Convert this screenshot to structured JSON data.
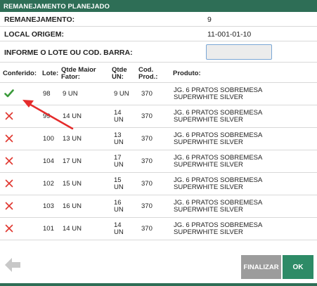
{
  "header": {
    "title": "REMANEJAMENTO PLANEJADO"
  },
  "info": {
    "remanejamento_label": "REMANEJAMENTO:",
    "remanejamento_value": "9",
    "local_origem_label": "LOCAL ORIGEM:",
    "local_origem_value": "11-001-01-10",
    "lote_label": "INFORME O LOTE OU COD. BARRA:",
    "lote_value": ""
  },
  "table": {
    "headers": {
      "conferido": "Conferido:",
      "lote": "Lote:",
      "qtde_maior_fator_1": "Qtde Maior",
      "qtde_maior_fator_2": "Fator:",
      "qtde_un_1": "Qtde",
      "qtde_un_2": "UN:",
      "cod_prod_1": "Cod.",
      "cod_prod_2": "Prod.:",
      "produto": "Produto:"
    },
    "rows": [
      {
        "status": "checked",
        "lote": "98",
        "qtde_maior_fator": "9 UN",
        "qtde_un_1": "9 UN",
        "qtde_un_2": "",
        "cod_prod": "370",
        "produto_1": "JG. 6 PRATOS SOBREMESA",
        "produto_2": "SUPERWHITE SILVER"
      },
      {
        "status": "unchecked",
        "lote": "99",
        "qtde_maior_fator": "14 UN",
        "qtde_un_1": "14",
        "qtde_un_2": "UN",
        "cod_prod": "370",
        "produto_1": "JG. 6 PRATOS SOBREMESA",
        "produto_2": "SUPERWHITE SILVER"
      },
      {
        "status": "unchecked",
        "lote": "100",
        "qtde_maior_fator": "13 UN",
        "qtde_un_1": "13",
        "qtde_un_2": "UN",
        "cod_prod": "370",
        "produto_1": "JG. 6 PRATOS SOBREMESA",
        "produto_2": "SUPERWHITE SILVER"
      },
      {
        "status": "unchecked",
        "lote": "104",
        "qtde_maior_fator": "17 UN",
        "qtde_un_1": "17",
        "qtde_un_2": "UN",
        "cod_prod": "370",
        "produto_1": "JG. 6 PRATOS SOBREMESA",
        "produto_2": "SUPERWHITE SILVER"
      },
      {
        "status": "unchecked",
        "lote": "102",
        "qtde_maior_fator": "15 UN",
        "qtde_un_1": "15",
        "qtde_un_2": "UN",
        "cod_prod": "370",
        "produto_1": "JG. 6 PRATOS SOBREMESA",
        "produto_2": "SUPERWHITE SILVER"
      },
      {
        "status": "unchecked",
        "lote": "103",
        "qtde_maior_fator": "16 UN",
        "qtde_un_1": "16",
        "qtde_un_2": "UN",
        "cod_prod": "370",
        "produto_1": "JG. 6 PRATOS SOBREMESA",
        "produto_2": "SUPERWHITE SILVER"
      },
      {
        "status": "unchecked",
        "lote": "101",
        "qtde_maior_fator": "14 UN",
        "qtde_un_1": "14",
        "qtde_un_2": "UN",
        "cod_prod": "370",
        "produto_1": "JG. 6 PRATOS SOBREMESA",
        "produto_2": "SUPERWHITE SILVER"
      }
    ]
  },
  "footer": {
    "back_icon": "arrow-left-icon",
    "finalizar_label": "FINALIZAR",
    "ok_label": "OK"
  },
  "annotation": {
    "icon": "red-arrow-icon",
    "color": "#e52b2b"
  },
  "colors": {
    "brand": "#2e6e56",
    "ok": "#2e8b67",
    "finalizar": "#9c9c9c",
    "check": "#3a9a3a",
    "cross": "#e0362f"
  }
}
